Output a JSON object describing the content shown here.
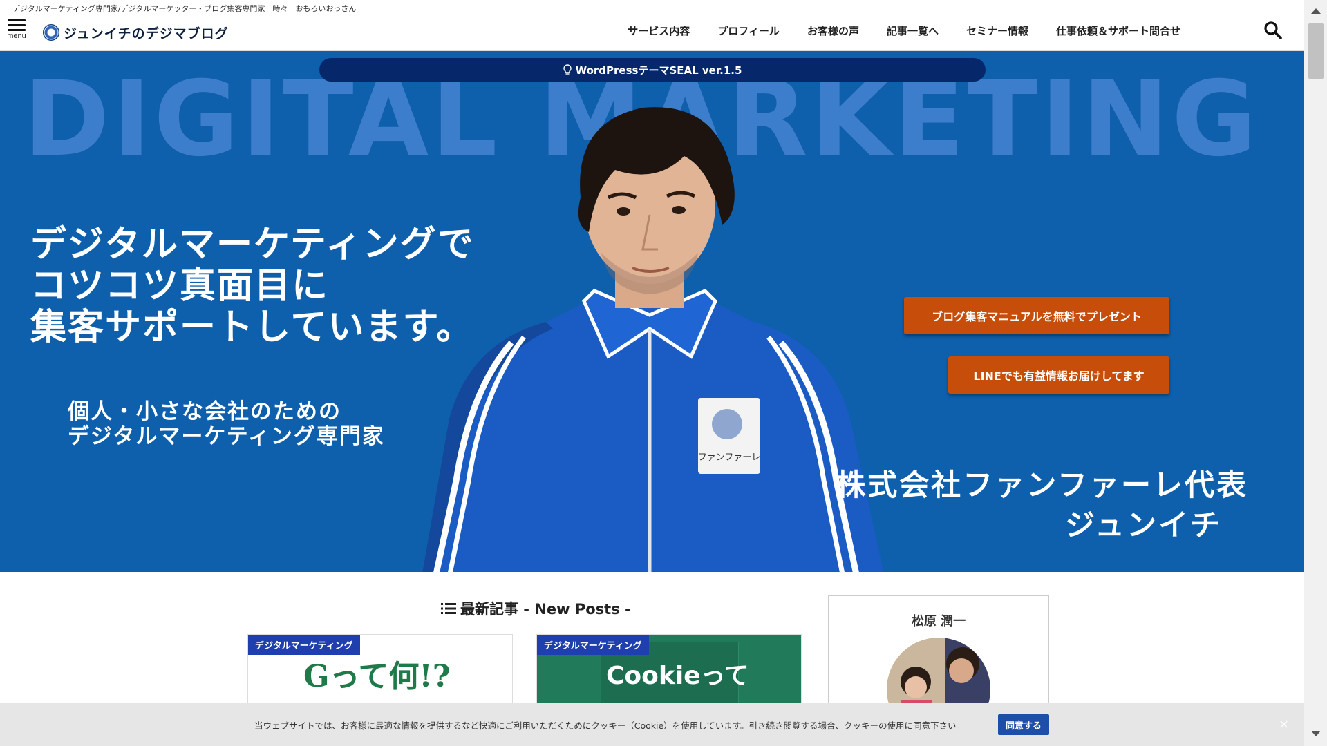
{
  "header": {
    "tagline": "デジタルマーケティング専門家/デジタルマーケッター・ブログ集客専門家　時々　おもろいおっさん",
    "menu_label": "menu",
    "logo_text": "ジュンイチのデジマブログ",
    "nav": [
      "サービス内容",
      "プロフィール",
      "お客様の声",
      "記事一覧へ",
      "セミナー情報",
      "仕事依頼＆サポート問合せ"
    ]
  },
  "hero": {
    "announce": "WordPressテーマSEAL ver.1.5",
    "bigtext": "DIGITAL MARKETING",
    "headline": [
      "デジタルマーケティングで",
      "コツコツ真面目に",
      "集客サポートしています。"
    ],
    "subhead": [
      "個人・小さな会社のための",
      "デジタルマーケティング専門家"
    ],
    "company": "株式会社ファンファーレ代表",
    "name": "ジュンイチ",
    "cta1": "ブログ集客マニュアルを無料でプレゼント",
    "cta2": "LINEでも有益情報お届けしてます",
    "patch_text": "ファンファーレ",
    "colors": {
      "background": "#0e5fac",
      "bigtext": "#3c7dcc",
      "cta": "#c64d0a",
      "announce": "#06286a"
    }
  },
  "main": {
    "section_title": "最新記事 - New Posts -",
    "cards": [
      {
        "category": "デジタルマーケティング",
        "art": "Gって何!?"
      },
      {
        "category": "デジタルマーケティング",
        "art": "Cookieって"
      }
    ]
  },
  "sidebar": {
    "profile_name": "松原 潤一"
  },
  "cookie": {
    "text": "当ウェブサイトでは、お客様に最適な情報を提供するなど快適にご利用いただくためにクッキー（Cookie）を使用しています。引き続き閲覧する場合、クッキーの使用に同意下さい。",
    "agree": "同意する",
    "close": "×"
  }
}
